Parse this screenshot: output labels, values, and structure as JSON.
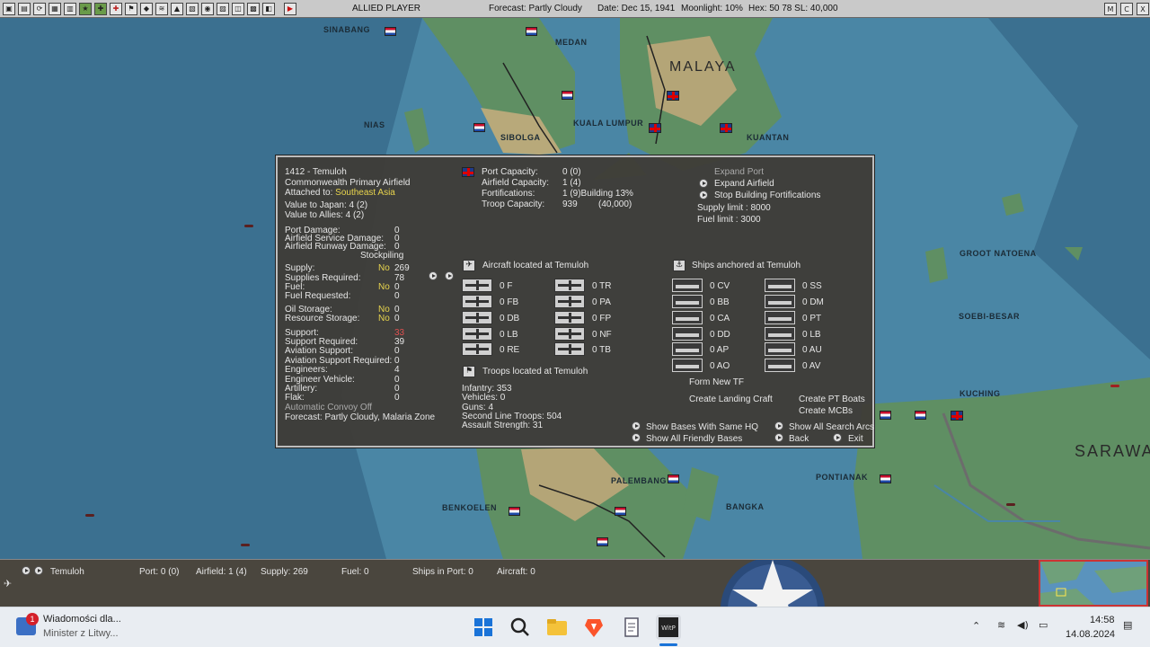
{
  "topbar": {
    "player": "ALLIED PLAYER",
    "forecast": "Forecast: Partly Cloudy",
    "date": "Date: Dec 15, 1941",
    "moonlight": "Moonlight: 10%",
    "hex": "Hex: 50 78  SL: 40,000",
    "right_buttons": [
      "M",
      "C",
      "X"
    ]
  },
  "map_labels": {
    "sinabang": "SINABANG",
    "medan": "MEDAN",
    "malaya": "MALAYA",
    "nias": "NIAS",
    "sibolga": "SIBOLGA",
    "kuala_lumpur": "KUALA LUMPUR",
    "kuantan": "KUANTAN",
    "groot_natoena": "GROOT NATOENA",
    "soebi_besar": "SOEBI-BESAR",
    "kuching": "KUCHING",
    "pontianak": "PONTIANAK",
    "sarawak": "SARAWA",
    "palembang": "PALEMBANG",
    "bangka": "BANGKA",
    "benkoelen": "BENKOELEN"
  },
  "base": {
    "title": "1412 - Temuloh",
    "type": "Commonwealth Primary Airfield",
    "attached_label": "Attached to: ",
    "attached_value": "Southeast Asia",
    "value_japan": "Value to Japan:  4 (2)",
    "value_allies": "Value to Allies:  4 (2)",
    "port_damage_label": "Port Damage:",
    "port_damage": "0",
    "af_service_label": "Airfield Service Damage:",
    "af_service": "0",
    "af_runway_label": "Airfield Runway Damage:",
    "af_runway": "0",
    "stockpiling": "Stockpiling",
    "supply_label": "Supply:",
    "supply_flag": "No",
    "supply": "269",
    "supplies_req_label": "Supplies Required:",
    "supplies_req": "78",
    "fuel_label": "Fuel:",
    "fuel_flag": "No",
    "fuel": "0",
    "fuel_req_label": "Fuel Requested:",
    "fuel_req": "0",
    "oil_label": "Oil Storage:",
    "oil_flag": "No",
    "oil": "0",
    "res_label": "Resource Storage:",
    "res_flag": "No",
    "res": "0",
    "support_label": "Support:",
    "support": "33",
    "support_req_label": "Support Required:",
    "support_req": "39",
    "av_support_label": "Aviation Support:",
    "av_support": "0",
    "av_support_req_label": "Aviation Support Required:",
    "av_support_req": "0",
    "engineers_label": "Engineers:",
    "engineers": "4",
    "eng_vehicle_label": "Engineer Vehicle:",
    "eng_vehicle": "0",
    "artillery_label": "Artillery:",
    "artillery": "0",
    "flak_label": "Flak:",
    "flak": "0",
    "convoy": "Automatic Convoy Off",
    "forecast": "Forecast: Partly Cloudy, Malaria Zone"
  },
  "capacity": {
    "port_label": "Port Capacity:",
    "port": "0 (0)",
    "airfield_label": "Airfield Capacity:",
    "airfield": "1 (4)",
    "fort_label": "Fortifications:",
    "fort": "1 (9)Building 13%",
    "troop_label": "Troop Capacity:",
    "troop": "939",
    "troop_max": "(40,000)"
  },
  "actions_top": {
    "expand_port": "Expand Port",
    "expand_airfield": "Expand Airfield",
    "stop_fort": "Stop Building Fortifications",
    "supply_limit": "Supply limit : 8000",
    "fuel_limit": "Fuel limit : 3000"
  },
  "aircraft": {
    "header": "Aircraft located at Temuloh",
    "left": [
      "0 F",
      "0 FB",
      "0 DB",
      "0 LB",
      "0 RE"
    ],
    "right": [
      "0 TR",
      "0 PA",
      "0 FP",
      "0 NF",
      "0 TB"
    ]
  },
  "ships": {
    "header": "Ships anchored at Temuloh",
    "left": [
      "0 CV",
      "0 BB",
      "0 CA",
      "0 DD",
      "0 AP",
      "0 AO"
    ],
    "right": [
      "0 SS",
      "0 DM",
      "0 PT",
      "0 LB",
      "0 AU",
      "0 AV"
    ]
  },
  "troops": {
    "header": "Troops located at Temuloh",
    "infantry": "Infantry: 353",
    "vehicles": "Vehicles: 0",
    "guns": "Guns: 4",
    "second_line": "Second Line Troops: 504",
    "assault": "Assault Strength: 31"
  },
  "ship_actions": {
    "form_tf": "Form New TF",
    "landing_craft": "Create Landing Craft",
    "pt_boats": "Create PT Boats",
    "mcbs": "Create MCBs"
  },
  "bottom_actions": {
    "show_hq": "Show Bases With Same HQ",
    "show_friendly": "Show All Friendly Bases",
    "show_arcs": "Show All Search Arcs",
    "back": "Back",
    "exit": "Exit"
  },
  "infobar": {
    "name": "Temuloh",
    "port": "Port: 0 (0)",
    "airfield": "Airfield: 1 (4)",
    "supply": "Supply: 269",
    "fuel": "Fuel: 0",
    "ships": "Ships in Port: 0",
    "aircraft": "Aircraft: 0"
  },
  "taskbar": {
    "notif_badge": "1",
    "news_title": "Wiadomości dla...",
    "news_sub": "Minister z Litwy...",
    "time": "14:58",
    "date": "14.08.2024"
  }
}
